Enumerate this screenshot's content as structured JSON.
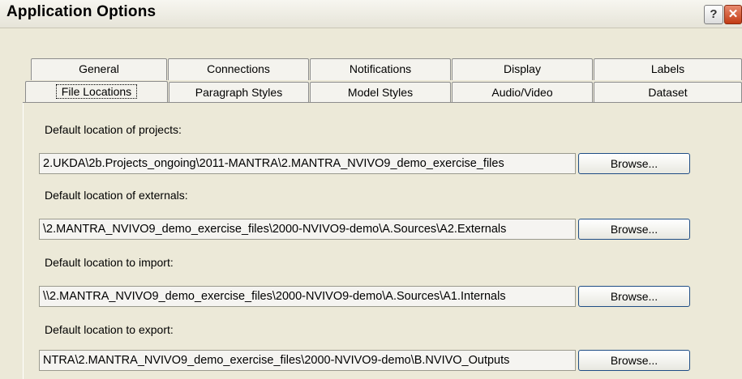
{
  "window": {
    "title": "Application Options",
    "help_glyph": "?",
    "close_glyph": "✕"
  },
  "tabs": {
    "row1": [
      "General",
      "Connections",
      "Notifications",
      "Display",
      "Labels"
    ],
    "row2": [
      "File Locations",
      "Paragraph Styles",
      "Model Styles",
      "Audio/Video",
      "Dataset"
    ],
    "active": "File Locations"
  },
  "locations": [
    {
      "label": "Default location of projects:",
      "value": "2.UKDA\\2b.Projects_ongoing\\2011-MANTRA\\2.MANTRA_NVIVO9_demo_exercise_files",
      "button": "Browse..."
    },
    {
      "label": "Default location of externals:",
      "value": "\\2.MANTRA_NVIVO9_demo_exercise_files\\2000-NVIVO9-demo\\A.Sources\\A2.Externals",
      "button": "Browse..."
    },
    {
      "label": "Default location to import:",
      "value": "\\\\2.MANTRA_NVIVO9_demo_exercise_files\\2000-NVIVO9-demo\\A.Sources\\A1.Internals",
      "button": "Browse..."
    },
    {
      "label": "Default location to export:",
      "value": "NTRA\\2.MANTRA_NVIVO9_demo_exercise_files\\2000-NVIVO9-demo\\B.NVIVO_Outputs",
      "button": "Browse..."
    }
  ]
}
